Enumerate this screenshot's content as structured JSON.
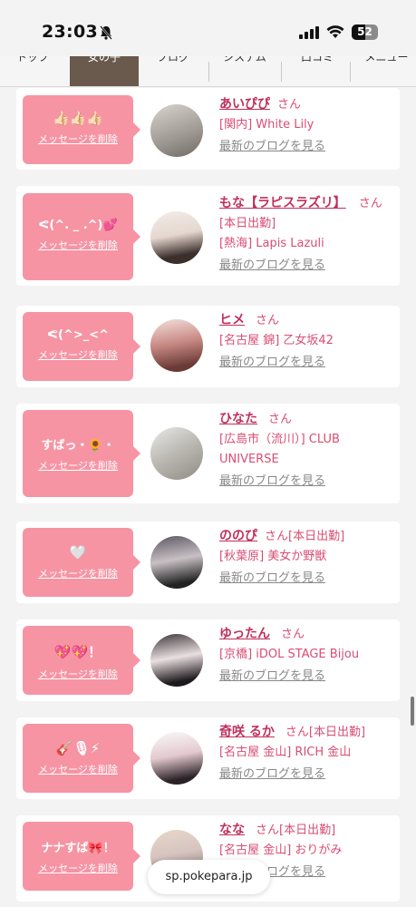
{
  "status": {
    "time": "23:03",
    "battery": "52"
  },
  "tabs": [
    "トップ",
    "女の子",
    "ブログ",
    "システム",
    "口コミ",
    "メニュー"
  ],
  "delete_label": "メッセージを削除",
  "blog_label": "最新のブログを見る",
  "honorific": "さん",
  "url": "sp.pokepara.jp",
  "cards": [
    {
      "message": "👍🏻👍🏻👍🏻",
      "name": "あいぴぴ",
      "extra": "",
      "shop_lines": [
        "[関内] White Lily"
      ]
    },
    {
      "message": "ᕙ(^. _ .^)💕",
      "name": "もな【ラピスラズリ】",
      "extra": "",
      "shop_lines": [
        "[本日出勤]",
        "[熱海] Lapis Lazuli"
      ]
    },
    {
      "message": "ᕙ(^>_<^",
      "name": "ヒメ",
      "extra": "",
      "shop_lines": [
        "[名古屋 錦] 乙女坂42"
      ]
    },
    {
      "message": "すばっ・🌻・",
      "name": "ひなた",
      "extra": "",
      "shop_lines": [
        "[広島市（流川）] CLUB UNIVERSE"
      ]
    },
    {
      "message": "🤍",
      "name": "ののぴ",
      "extra": "[本日出勤]",
      "shop_lines": [
        "[秋葉原] 美女か野獣"
      ]
    },
    {
      "message": "💖💖！",
      "name": "ゆったん",
      "extra": "",
      "shop_lines": [
        "[京橋] iDOL STAGE Bijou"
      ]
    },
    {
      "message": "🎸🎙⚡",
      "name": "奇咲 るか",
      "extra": "[本日出勤]",
      "shop_lines": [
        "[名古屋 金山] RICH 金山"
      ]
    },
    {
      "message": "ナナすば🎀！",
      "name": "なな",
      "extra": "[本日出勤]",
      "shop_lines": [
        "[名古屋 金山] おりがみ"
      ]
    }
  ],
  "colors": {
    "accent": "#f694a4",
    "link_pink": "#d94d73",
    "tab_active": "#6a5a4d"
  }
}
